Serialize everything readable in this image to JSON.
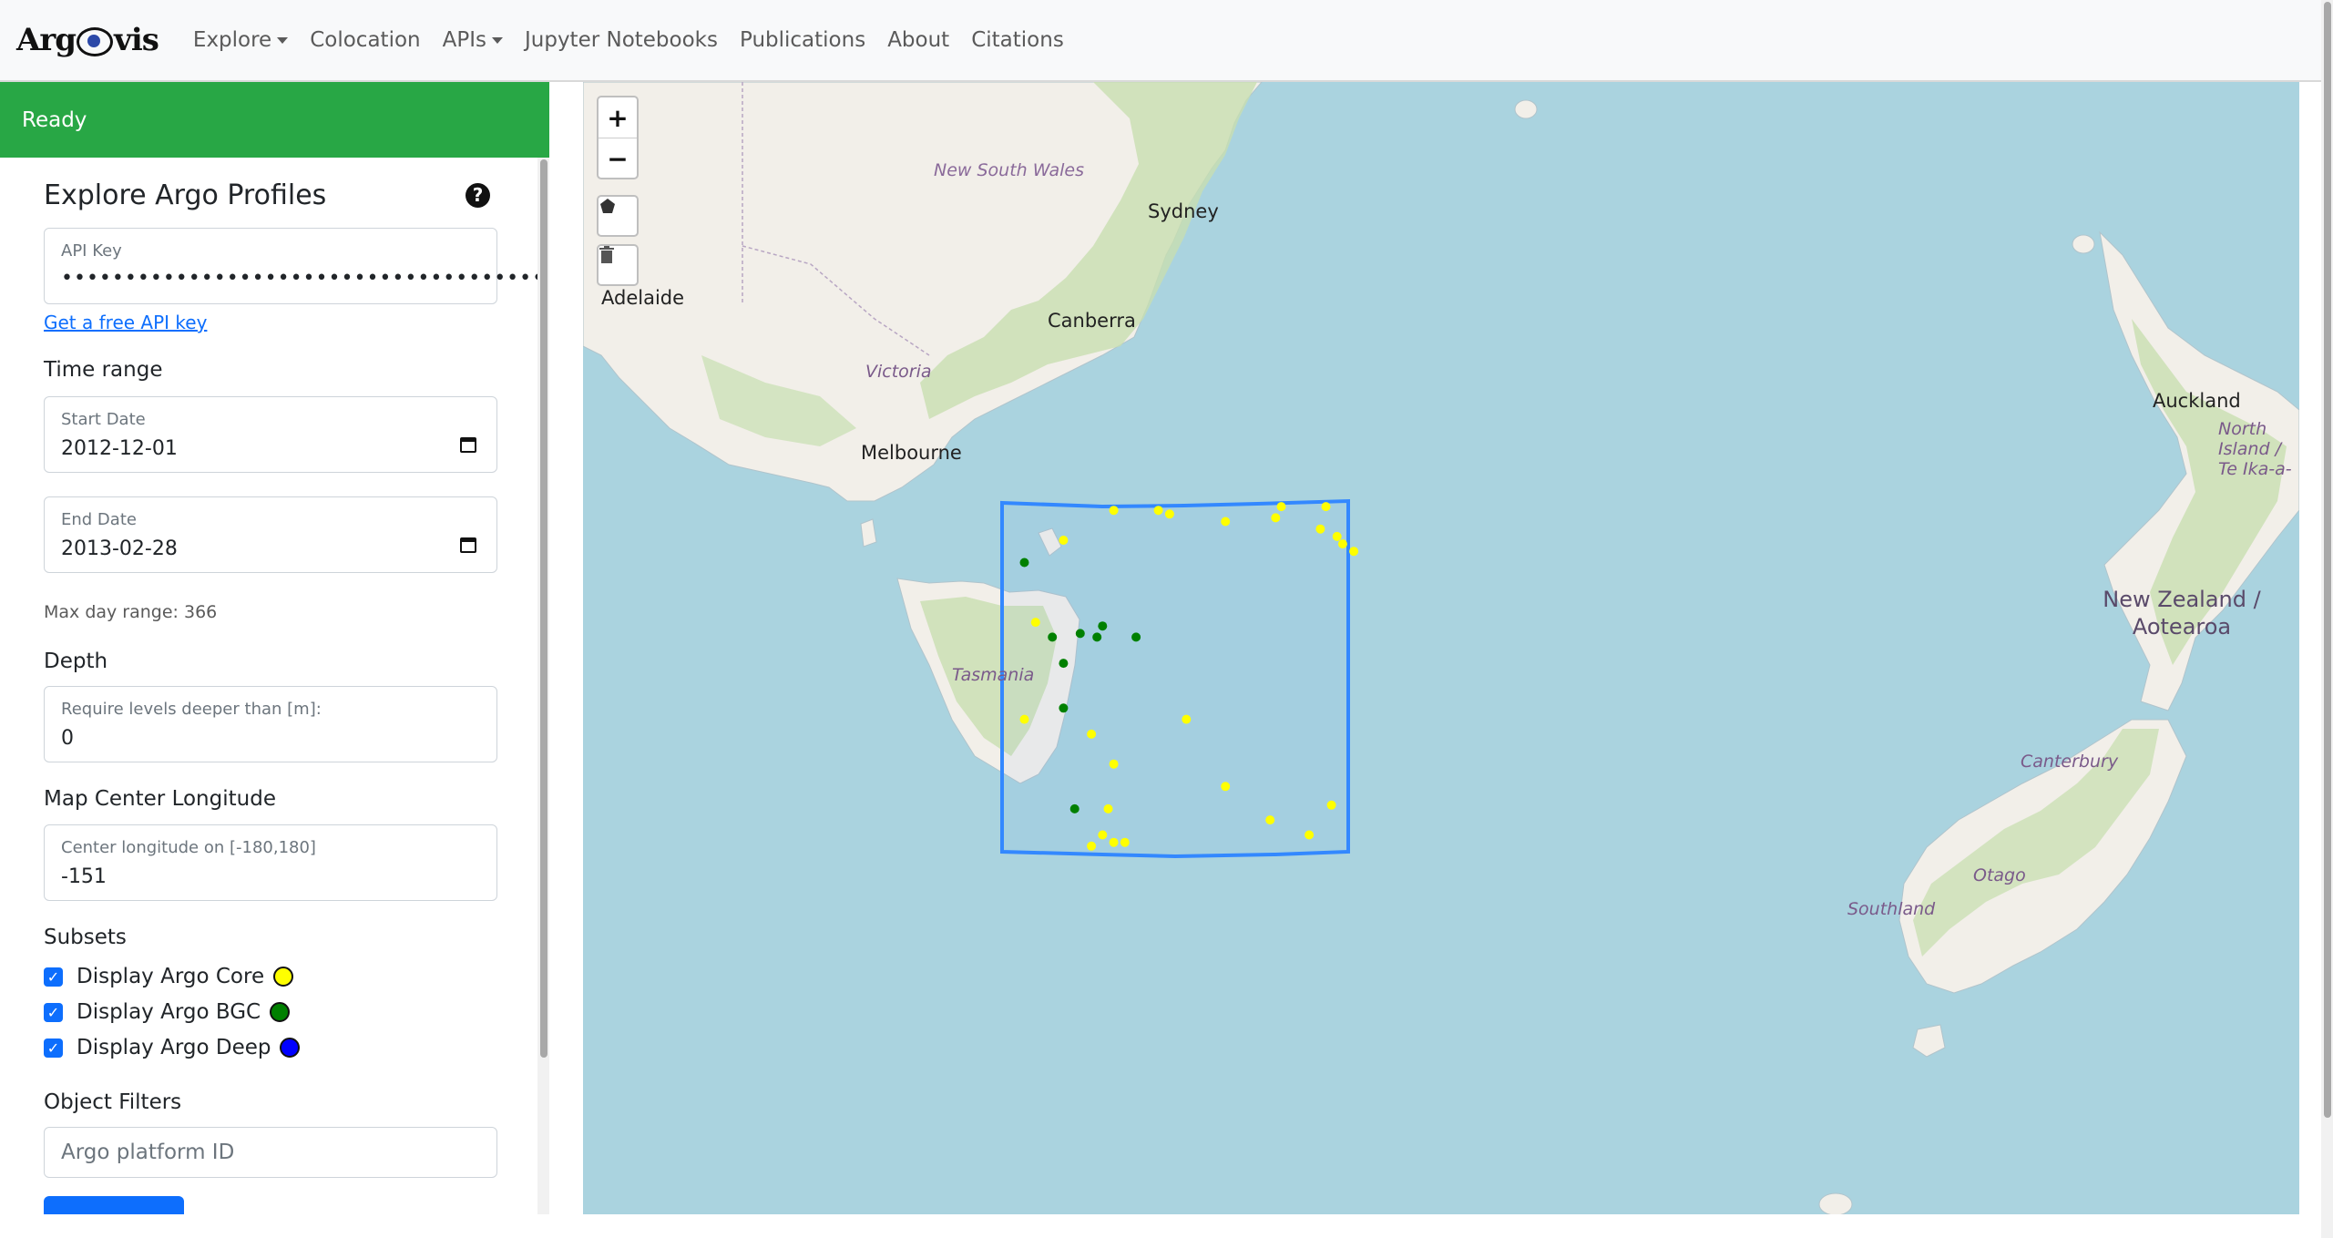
{
  "navbar": {
    "brand": "Argovis",
    "items": [
      {
        "label": "Explore",
        "dropdown": true
      },
      {
        "label": "Colocation",
        "dropdown": false
      },
      {
        "label": "APIs",
        "dropdown": true
      },
      {
        "label": "Jupyter Notebooks",
        "dropdown": false
      },
      {
        "label": "Publications",
        "dropdown": false
      },
      {
        "label": "About",
        "dropdown": false
      },
      {
        "label": "Citations",
        "dropdown": false
      }
    ]
  },
  "status": {
    "text": "Ready",
    "color": "#28a745"
  },
  "sidebar": {
    "title": "Explore Argo Profiles",
    "api_key": {
      "label": "API Key",
      "value": "••••••••••••••••••••••••••••••••••••••••"
    },
    "api_link": "Get a free API key",
    "time_range": {
      "label": "Time range",
      "start_label": "Start Date",
      "start_value": "2012-12-01",
      "end_label": "End Date",
      "end_value": "2013-02-28",
      "max_range": "Max day range: 366"
    },
    "depth": {
      "label": "Depth",
      "field_label": "Require levels deeper than [m]:",
      "value": "0"
    },
    "center": {
      "label": "Map Center Longitude",
      "field_label": "Center longitude on [-180,180]",
      "value": "-151"
    },
    "subsets": {
      "label": "Subsets",
      "items": [
        {
          "label": "Display Argo Core",
          "checked": true,
          "color": "#ffff00"
        },
        {
          "label": "Display Argo BGC",
          "checked": true,
          "color": "#008000"
        },
        {
          "label": "Display Argo Deep",
          "checked": true,
          "color": "#0000ff"
        }
      ]
    },
    "filters": {
      "label": "Object Filters",
      "placeholder": "Argo platform ID"
    }
  },
  "map": {
    "controls": {
      "zoom_in": "+",
      "zoom_out": "−"
    },
    "labels": {
      "new_south_wales": "New South Wales",
      "sydney": "Sydney",
      "adelaide": "Adelaide",
      "canberra": "Canberra",
      "victoria": "Victoria",
      "melbourne": "Melbourne",
      "tasmania": "Tasmania",
      "auckland": "Auckland",
      "north_island": "North Island / Te Ika-a-Māui",
      "new_zealand": "New Zealand / Aotearoa",
      "canterbury": "Canterbury",
      "otago": "Otago",
      "southland": "Southland"
    },
    "colors": {
      "ocean": "#aad3df",
      "land": "#f2efe9",
      "forest": "#c8dfb0",
      "selection": "#3388ff"
    },
    "core_profiles": [
      [
        -150.4,
        -38.2
      ],
      [
        -149.6,
        -38.2
      ],
      [
        -149.4,
        -38.3
      ],
      [
        -148.4,
        -38.5
      ],
      [
        -147.5,
        -38.4
      ],
      [
        -147.4,
        -38.1
      ],
      [
        -146.7,
        -38.7
      ],
      [
        -146.4,
        -38.9
      ],
      [
        -146.1,
        -39.3
      ],
      [
        -146.3,
        -39.1
      ],
      [
        -146.6,
        -38.1
      ],
      [
        -151.3,
        -39.0
      ],
      [
        -151.8,
        -41.2
      ],
      [
        -152.0,
        -43.8
      ],
      [
        -150.8,
        -44.2
      ],
      [
        -150.4,
        -45.0
      ],
      [
        -149.1,
        -43.8
      ],
      [
        -148.4,
        -45.6
      ],
      [
        -147.6,
        -46.5
      ],
      [
        -146.9,
        -46.9
      ],
      [
        -146.5,
        -46.1
      ],
      [
        -150.5,
        -46.2
      ],
      [
        -150.6,
        -46.9
      ],
      [
        -150.2,
        -47.1
      ],
      [
        -150.4,
        -47.1
      ],
      [
        -150.8,
        -47.2
      ]
    ],
    "bgc_profiles": [
      [
        -152.0,
        -39.6
      ],
      [
        -151.0,
        -41.5
      ],
      [
        -151.5,
        -41.6
      ],
      [
        -150.6,
        -41.3
      ],
      [
        -150.7,
        -41.6
      ],
      [
        -150.0,
        -41.6
      ],
      [
        -151.3,
        -42.3
      ],
      [
        -151.3,
        -43.5
      ],
      [
        -151.1,
        -46.2
      ]
    ]
  }
}
